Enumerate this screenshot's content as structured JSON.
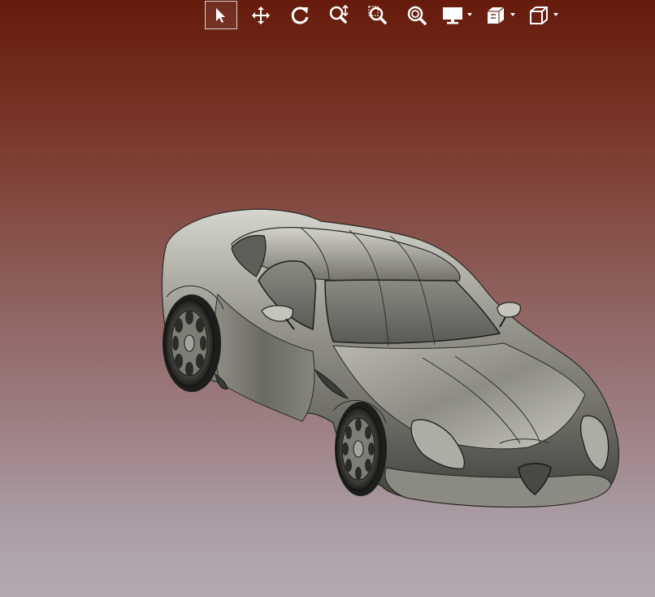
{
  "toolbar": {
    "tools": [
      {
        "name": "select",
        "icon": "cursor-arrow-icon",
        "active": true
      },
      {
        "name": "pan",
        "icon": "pan-move-icon"
      },
      {
        "name": "rotate",
        "icon": "rotate-icon"
      },
      {
        "name": "zoom",
        "icon": "zoom-icon"
      },
      {
        "name": "zoom-window",
        "icon": "zoom-window-icon"
      },
      {
        "name": "zoom-fit",
        "icon": "zoom-fit-icon"
      },
      {
        "name": "display-mode",
        "icon": "monitor-icon",
        "dropdown": true
      },
      {
        "name": "section-view",
        "icon": "section-box-icon",
        "dropdown": true
      },
      {
        "name": "standard-views",
        "icon": "cube-view-icon",
        "dropdown": true
      }
    ],
    "icon_color": "#ffffff",
    "active_border_color": "#d9cfcf"
  },
  "viewport": {
    "background_top": "#661b0c",
    "background_bottom": "#b3a9b3",
    "model": "sports-car"
  }
}
